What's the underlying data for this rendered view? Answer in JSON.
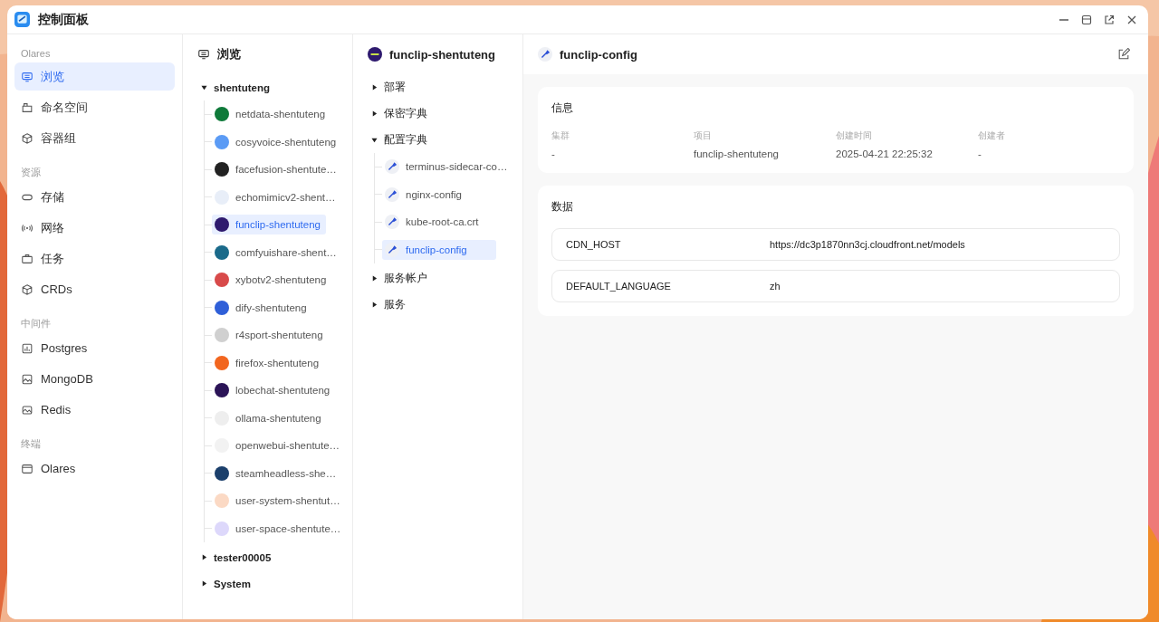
{
  "window": {
    "title": "控制面板"
  },
  "sidebar": {
    "sections": [
      {
        "label": "Olares",
        "items": [
          {
            "label": "浏览",
            "selected": true
          },
          {
            "label": "命名空间",
            "selected": false
          },
          {
            "label": "容器组",
            "selected": false
          }
        ]
      },
      {
        "label": "资源",
        "items": [
          {
            "label": "存储",
            "selected": false
          },
          {
            "label": "网络",
            "selected": false
          },
          {
            "label": "任务",
            "selected": false
          },
          {
            "label": "CRDs",
            "selected": false
          }
        ]
      },
      {
        "label": "中间件",
        "items": [
          {
            "label": "Postgres",
            "selected": false
          },
          {
            "label": "MongoDB",
            "selected": false
          },
          {
            "label": "Redis",
            "selected": false
          }
        ]
      },
      {
        "label": "终端",
        "items": [
          {
            "label": "Olares",
            "selected": false
          }
        ]
      }
    ]
  },
  "browser": {
    "title": "浏览",
    "tree": [
      {
        "label": "shentuteng",
        "expanded": true,
        "children": [
          {
            "label": "netdata-shentuteng",
            "selected": false,
            "color": "#0f7a3a"
          },
          {
            "label": "cosyvoice-shentuteng",
            "selected": false,
            "color": "#5b9bf5"
          },
          {
            "label": "facefusion-shentute…",
            "selected": false,
            "color": "#222222"
          },
          {
            "label": "echomimicv2-shent…",
            "selected": false,
            "color": "#e8eef8"
          },
          {
            "label": "funclip-shentuteng",
            "selected": true,
            "color": "#2e1a6e"
          },
          {
            "label": "comfyuishare-shent…",
            "selected": false,
            "color": "#1a6a8a"
          },
          {
            "label": "xybotv2-shentuteng",
            "selected": false,
            "color": "#d84a4a"
          },
          {
            "label": "dify-shentuteng",
            "selected": false,
            "color": "#2f5fd8"
          },
          {
            "label": "r4sport-shentuteng",
            "selected": false,
            "color": "#d0d0d0"
          },
          {
            "label": "firefox-shentuteng",
            "selected": false,
            "color": "#f2661f"
          },
          {
            "label": "lobechat-shentuteng",
            "selected": false,
            "color": "#2b1457"
          },
          {
            "label": "ollama-shentuteng",
            "selected": false,
            "color": "#eeeeee"
          },
          {
            "label": "openwebui-shentute…",
            "selected": false,
            "color": "#f2f2f2"
          },
          {
            "label": "steamheadless-she…",
            "selected": false,
            "color": "#1b3f6b"
          },
          {
            "label": "user-system-shentut…",
            "selected": false,
            "color": "#fbd9c4"
          },
          {
            "label": "user-space-shentute…",
            "selected": false,
            "color": "#ddd8fb"
          }
        ]
      },
      {
        "label": "tester00005",
        "expanded": false
      },
      {
        "label": "System",
        "expanded": false
      }
    ]
  },
  "project": {
    "title": "funclip-shentuteng",
    "groups": [
      {
        "label": "部署",
        "expanded": false
      },
      {
        "label": "保密字典",
        "expanded": false
      },
      {
        "label": "配置字典",
        "expanded": true,
        "children": [
          {
            "label": "terminus-sidecar-co…",
            "selected": false
          },
          {
            "label": "nginx-config",
            "selected": false
          },
          {
            "label": "kube-root-ca.crt",
            "selected": false
          },
          {
            "label": "funclip-config",
            "selected": true
          }
        ]
      },
      {
        "label": "服务帐户",
        "expanded": false
      },
      {
        "label": "服务",
        "expanded": false
      }
    ]
  },
  "detail": {
    "title": "funclip-config",
    "info": {
      "title": "信息",
      "fields": [
        {
          "label": "集群",
          "value": "-"
        },
        {
          "label": "项目",
          "value": "funclip-shentuteng"
        },
        {
          "label": "创建时间",
          "value": "2025-04-21 22:25:32"
        },
        {
          "label": "创建者",
          "value": "-"
        }
      ]
    },
    "data": {
      "title": "数据",
      "rows": [
        {
          "key": "CDN_HOST",
          "value": "https://dc3p1870nn3cj.cloudfront.net/models"
        },
        {
          "key": "DEFAULT_LANGUAGE",
          "value": "zh"
        }
      ]
    }
  }
}
